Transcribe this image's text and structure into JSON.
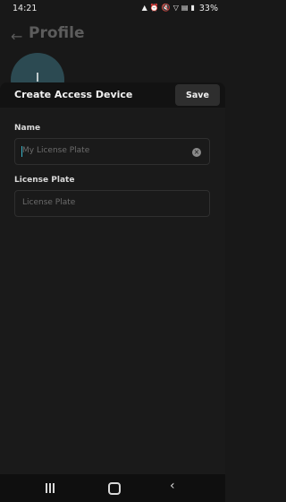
{
  "status_bar": {
    "time": "14:21",
    "battery_percent": "33%",
    "icons": [
      "signal-icon",
      "alarm-icon",
      "mute-icon",
      "wifi-icon",
      "lte-icon",
      "battery-icon"
    ]
  },
  "header": {
    "title": "Profile",
    "back_icon": "arrow-left-icon"
  },
  "sheet": {
    "title": "Create Access Device",
    "save_label": "Save",
    "fields": [
      {
        "label": "Name",
        "placeholder": "My License Plate",
        "value": ""
      },
      {
        "label": "License Plate",
        "placeholder": "License Plate",
        "value": ""
      }
    ]
  },
  "nav_bar": {
    "icons": [
      "recent-apps-icon",
      "home-icon",
      "back-icon"
    ]
  },
  "colors": {
    "background": "#181818",
    "sheet": "#1a1a1a",
    "sheet_header": "#121212",
    "accent": "#3ab5c8"
  }
}
